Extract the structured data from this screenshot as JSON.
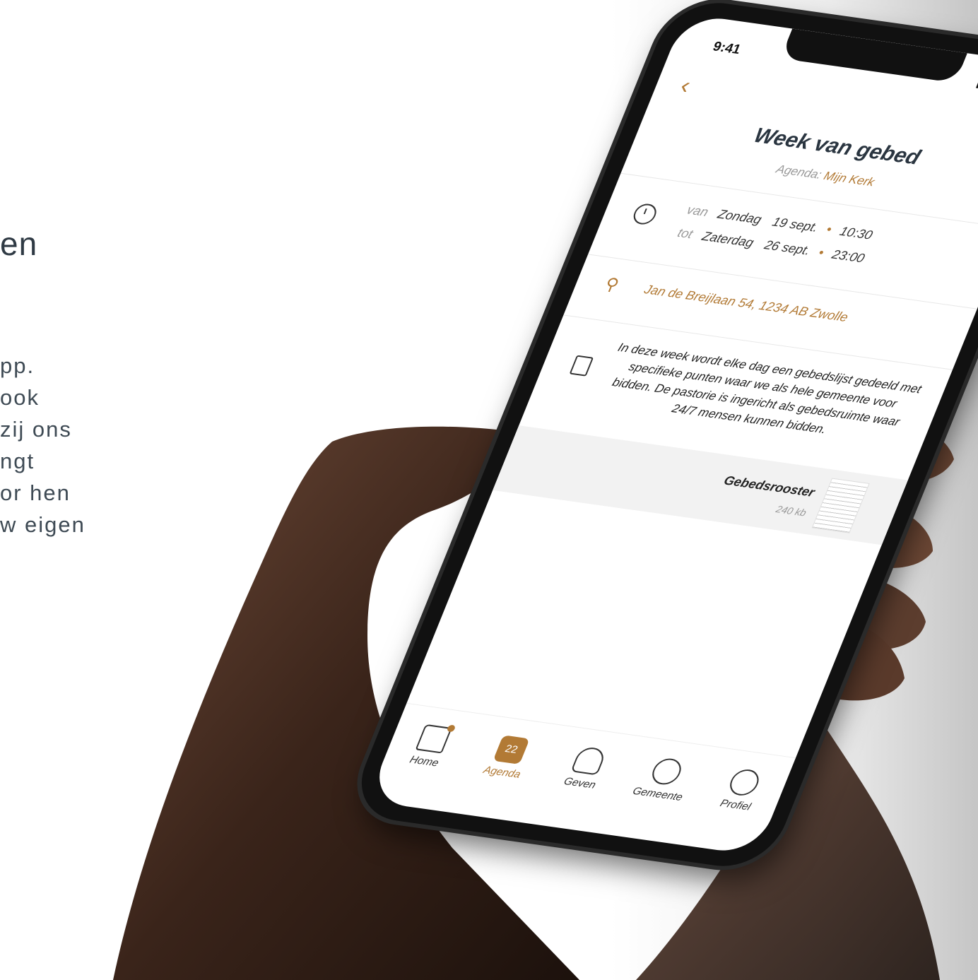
{
  "left_copy": {
    "heading_fragment": "en",
    "paragraph_fragments": [
      "pp.",
      "ook",
      "zij ons",
      "ngt",
      "or hen",
      "w eigen"
    ]
  },
  "status_bar": {
    "time": "9:41",
    "icons": "▮▮▮ • ▬"
  },
  "nav": {
    "back_icon": "chevron-left-icon",
    "back_glyph": "‹",
    "more_icon": "more-horizontal-icon",
    "more_glyph": "•••"
  },
  "event": {
    "title": "Week van gebed",
    "agenda_label": "Agenda:",
    "agenda_name": "Mijn Kerk",
    "from_label": "van",
    "from_day": "Zondag",
    "from_date": "19 sept.",
    "from_time": "10:30",
    "to_label": "tot",
    "to_day": "Zaterdag",
    "to_date": "26 sept.",
    "to_time": "23:00",
    "separator": "•",
    "location": "Jan de Breijlaan 54, 1234 AB Zwolle",
    "description": "In deze week wordt elke dag een gebedslijst gedeeld met specifieke punten waar we als hele gemeente voor bidden. De pastorie is ingericht als gebedsruimte waar 24/7 mensen kunnen bidden."
  },
  "attachment": {
    "name": "Gebedsrooster",
    "size": "240 kb"
  },
  "tabbar": {
    "items": [
      {
        "label": "Home",
        "icon": "home-icon",
        "active": false,
        "badge": true
      },
      {
        "label": "Agenda",
        "icon": "calendar-icon",
        "active": true,
        "calendar_day": "22"
      },
      {
        "label": "Geven",
        "icon": "give-heart-icon",
        "active": false
      },
      {
        "label": "Gemeente",
        "icon": "community-icon",
        "active": false
      },
      {
        "label": "Profiel",
        "icon": "profile-icon",
        "active": false
      }
    ]
  },
  "colors": {
    "accent": "#b27a35",
    "text": "#2a3540",
    "muted": "#999999"
  }
}
